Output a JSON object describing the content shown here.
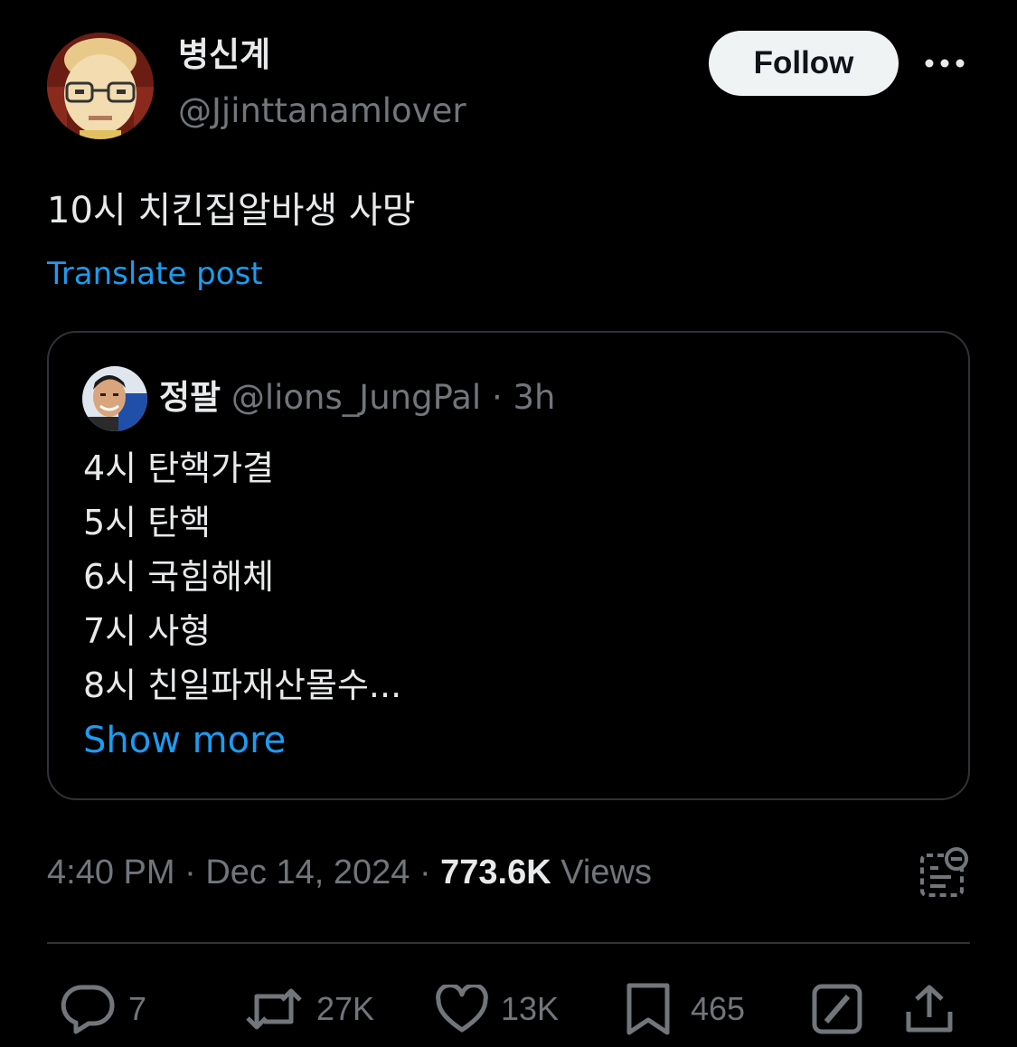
{
  "author": {
    "display_name": "병신계",
    "handle": "@Jjinttanamlover"
  },
  "follow_label": "Follow",
  "post": {
    "text": "10시 치킨집알바생 사망",
    "translate_label": "Translate post"
  },
  "quote": {
    "display_name": "정팔",
    "handle": "@lions_JungPal",
    "separator": "·",
    "age": "3h",
    "lines": [
      "4시 탄핵가결",
      "5시 탄핵",
      "6시 국힘해체",
      "7시 사형",
      "8시 친일파재산몰수..."
    ],
    "show_more_label": "Show more"
  },
  "meta": {
    "time": "4:40 PM",
    "separator": "·",
    "date": "Dec 14, 2024",
    "views_count": "773.6K",
    "views_label": "Views"
  },
  "actions": {
    "replies": "7",
    "reposts": "27K",
    "likes": "13K",
    "bookmarks": "465"
  },
  "colors": {
    "background": "#000000",
    "text": "#e7e9ea",
    "muted": "#71767b",
    "link": "#1d9bf0",
    "border": "#2f3336",
    "follow_bg": "#eff3f4"
  },
  "icons": [
    "more-icon",
    "analytics-icon",
    "reply-icon",
    "repost-icon",
    "like-icon",
    "bookmark-icon",
    "grok-icon",
    "share-icon"
  ]
}
